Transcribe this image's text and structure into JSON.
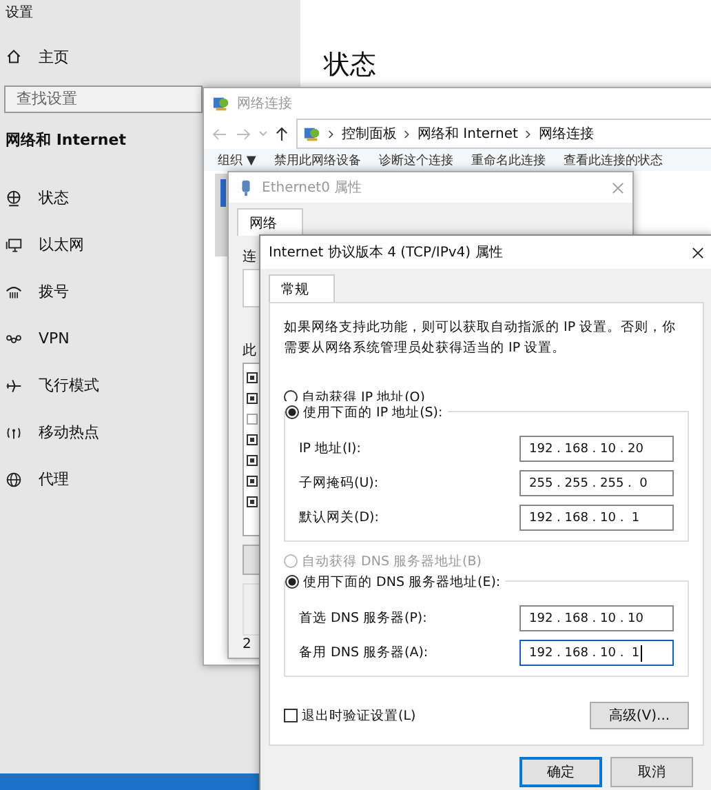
{
  "settings": {
    "title": "设置",
    "home": "主页",
    "search": {
      "placeholder": "查找设置"
    },
    "section": "网络和 Internet",
    "nav": [
      {
        "label": "状态",
        "kind": "status"
      },
      {
        "label": "以太网",
        "kind": "ethernet"
      },
      {
        "label": "拨号",
        "kind": "dialup"
      },
      {
        "label": "VPN",
        "kind": "vpn"
      },
      {
        "label": "飞行模式",
        "kind": "airplane"
      },
      {
        "label": "移动热点",
        "kind": "hotspot"
      },
      {
        "label": "代理",
        "kind": "proxy"
      }
    ],
    "page_title": "状态"
  },
  "network_window": {
    "title": "网络连接",
    "breadcrumb": [
      "控制面板",
      "网络和 Internet",
      "网络连接"
    ],
    "toolbar": [
      "组织 ▼",
      "禁用此网络设备",
      "诊断这个连接",
      "重命名此连接",
      "查看此连接的状态"
    ]
  },
  "ethernet_window": {
    "title": "Ethernet0 属性",
    "tabs": [
      {
        "label": "网络",
        "selected": true
      }
    ],
    "items": [
      {
        "checked": true
      },
      {
        "checked": true
      },
      {
        "checked": false
      },
      {
        "checked": true
      },
      {
        "checked": true
      },
      {
        "checked": true
      },
      {
        "checked": true
      }
    ],
    "label_1": "连",
    "label_2": "此",
    "footer": "2"
  },
  "ipv4_dialog": {
    "title": "Internet 协议版本 4 (TCP/IPv4) 属性",
    "tabs": [
      {
        "label": "常规",
        "selected": true
      }
    ],
    "description": "如果网络支持此功能，则可以获取自动指派的 IP 设置。否则，你需要从网络系统管理员处获得适当的 IP 设置。",
    "ip_auto": {
      "label": "自动获得 IP 地址(O)",
      "selected": false,
      "disabled": false
    },
    "ip_manual": {
      "label": "使用下面的 IP 地址(S):",
      "selected": true,
      "disabled": false
    },
    "ip_fields": [
      {
        "label": "IP 地址(I):",
        "value": "192 . 168 . 10 . 20",
        "focused": false
      },
      {
        "label": "子网掩码(U):",
        "value": "255 . 255 . 255 .  0",
        "focused": false
      },
      {
        "label": "默认网关(D):",
        "value": "192 . 168 . 10 .  1",
        "focused": false
      }
    ],
    "dns_auto": {
      "label": "自动获得 DNS 服务器地址(B)",
      "selected": false,
      "disabled": true
    },
    "dns_manual": {
      "label": "使用下面的 DNS 服务器地址(E):",
      "selected": true,
      "disabled": false
    },
    "dns_fields": [
      {
        "label": "首选 DNS 服务器(P):",
        "value": "192 . 168 . 10 . 10",
        "focused": false
      },
      {
        "label": "备用 DNS 服务器(A):",
        "value": "192 . 168 . 10 .  1",
        "focused": true
      }
    ],
    "validate": {
      "label": "退出时验证设置(L)",
      "checked": false
    },
    "advanced": "高级(V)...",
    "ok": "确定",
    "cancel": "取消"
  }
}
